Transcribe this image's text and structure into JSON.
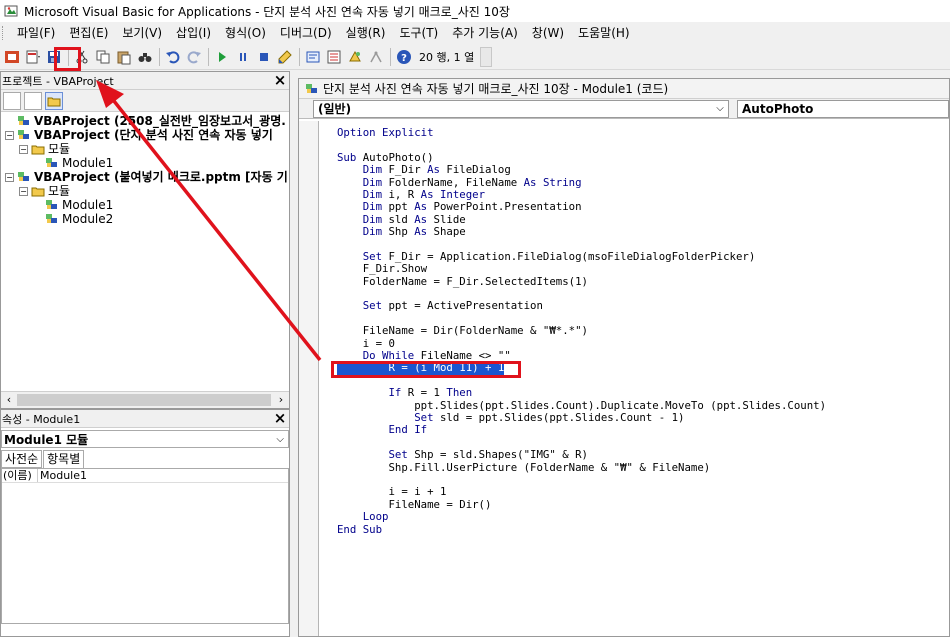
{
  "window": {
    "title": "Microsoft Visual Basic for Applications - 단지 분석 사진 연속 자동 넣기 매크로_사진 10장"
  },
  "menubar": {
    "items": [
      {
        "label": "파일(F)"
      },
      {
        "label": "편집(E)"
      },
      {
        "label": "보기(V)"
      },
      {
        "label": "삽입(I)"
      },
      {
        "label": "형식(O)"
      },
      {
        "label": "디버그(D)"
      },
      {
        "label": "실행(R)"
      },
      {
        "label": "도구(T)"
      },
      {
        "label": "추가 기능(A)"
      },
      {
        "label": "창(W)"
      },
      {
        "label": "도움말(H)"
      }
    ]
  },
  "toolbar": {
    "status": "20 행, 1 열",
    "highlight_color": "#e0121c"
  },
  "project_panel": {
    "header": "프로젝트 - VBAProject",
    "close_label": "×",
    "tree": [
      {
        "indent": 0,
        "expander": "",
        "label": "VBAProject (2508_실전반_임장보고서_광명.",
        "bold": true,
        "icon": "vba-project-icon"
      },
      {
        "indent": 0,
        "expander": "−",
        "label": "VBAProject (단지 분석 사진 연속 자동 넣기",
        "bold": true,
        "icon": "vba-project-icon"
      },
      {
        "indent": 1,
        "expander": "−",
        "label": "모듈",
        "bold": false,
        "icon": "folder-icon"
      },
      {
        "indent": 2,
        "expander": "",
        "label": "Module1",
        "bold": false,
        "icon": "module-icon"
      },
      {
        "indent": 0,
        "expander": "−",
        "label": "VBAProject (붙여넣기 매크로.pptm [자동 기",
        "bold": true,
        "icon": "vba-project-icon"
      },
      {
        "indent": 1,
        "expander": "−",
        "label": "모듈",
        "bold": false,
        "icon": "folder-icon"
      },
      {
        "indent": 2,
        "expander": "",
        "label": "Module1",
        "bold": false,
        "icon": "module-icon"
      },
      {
        "indent": 2,
        "expander": "",
        "label": "Module2",
        "bold": false,
        "icon": "module-icon"
      }
    ]
  },
  "props_panel": {
    "header": "속성 - Module1",
    "close_label": "×",
    "select_value": "Module1 모듈",
    "tabs": [
      {
        "label": "사전순"
      },
      {
        "label": "항목별"
      }
    ],
    "rows": [
      {
        "key": "(이름)",
        "value": "Module1"
      }
    ]
  },
  "code_window": {
    "title": "단지 분석 사진 연속 자동 넣기 매크로_사진 10장 - Module1 (코드)",
    "object_combo": "(일반)",
    "proc_combo": "AutoPhoto",
    "lines": [
      "Option Explicit",
      "",
      "Sub AutoPhoto()",
      "    Dim F_Dir As FileDialog",
      "    Dim FolderName, FileName As String",
      "    Dim i, R As Integer",
      "    Dim ppt As PowerPoint.Presentation",
      "    Dim sld As Slide",
      "    Dim Shp As Shape",
      "",
      "    Set F_Dir = Application.FileDialog(msoFileDialogFolderPicker)",
      "    F_Dir.Show",
      "    FolderName = F_Dir.SelectedItems(1)",
      "",
      "    Set ppt = ActivePresentation",
      "",
      "    FileName = Dir(FolderName & \"₩*.*\")",
      "    i = 0",
      "    Do While FileName <> \"\"",
      "        R = (i Mod 11) + 1",
      "",
      "        If R = 1 Then",
      "            ppt.Slides(ppt.Slides.Count).Duplicate.MoveTo (ppt.Slides.Count)",
      "            Set sld = ppt.Slides(ppt.Slides.Count - 1)",
      "        End If",
      "",
      "        Set Shp = sld.Shapes(\"IMG\" & R)",
      "        Shp.Fill.UserPicture (FolderName & \"₩\" & FileName)",
      "",
      "        i = i + 1",
      "        FileName = Dir()",
      "    Loop",
      "End Sub"
    ],
    "selected_line": 19
  }
}
